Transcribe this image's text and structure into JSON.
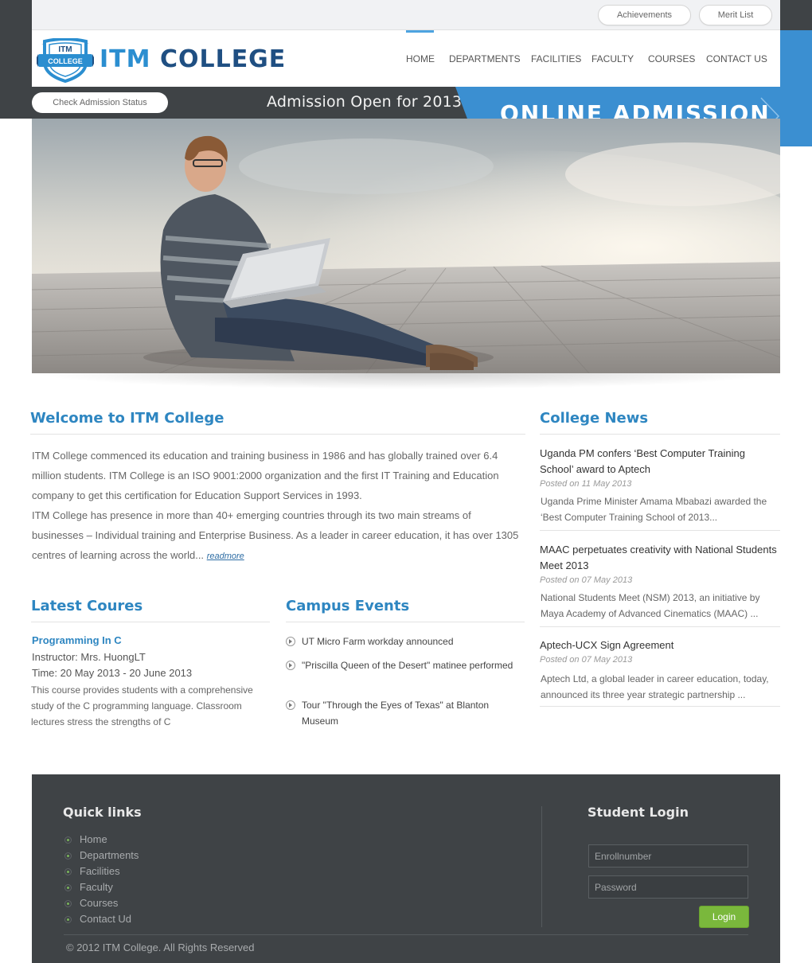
{
  "top_links": [
    "Achievements",
    "Merit List"
  ],
  "logo": {
    "badge_top": "ITM",
    "badge_bottom": "COLLEGE",
    "brand_part1": "ITM",
    "brand_part2": "COLLEGE"
  },
  "nav": [
    "HOME",
    "DEPARTMENTS",
    "FACILITIES",
    "FACULTY",
    "COURSES",
    "CONTACT US"
  ],
  "band": {
    "check_status": "Check Admission Status",
    "admission": "Admission Open for 2013",
    "online_admission": "ONLINE ADMISSION"
  },
  "welcome": {
    "title": "Welcome to ITM College",
    "para1": "ITM College commenced its education and training business in 1986 and has globally trained over 6.4 million students. ITM College is an ISO 9001:2000 organization and the first IT Training and Education company to get this certification for Education Support Services in 1993.",
    "para2": "ITM College has presence in more than 40+ emerging countries through its two main streams of businesses – Individual training and Enterprise Business. As a leader in career education, it has over 1305 centres of learning across the world...",
    "readmore": "readmore"
  },
  "courses": {
    "title": "Latest Coures",
    "name": "Programming In C",
    "instructor": "Instructor: Mrs. HuongLT",
    "time": "Time: 20 May 2013 - 20 June 2013",
    "description": "This course provides students with a comprehensive study of the C programming language. Classroom lectures stress the strengths of C"
  },
  "events": {
    "title": "Campus Events",
    "items": [
      "UT Micro Farm workday announced",
      "\"Priscilla Queen of the Desert\" matinee performed",
      "Tour \"Through the Eyes of Texas\" at Blanton Museum"
    ]
  },
  "news": {
    "title": "College News",
    "items": [
      {
        "title": "Uganda PM confers ‘Best Computer Training School’ award to Aptech",
        "date": "Posted on 11 May 2013",
        "body": "Uganda Prime Minister Amama Mbabazi awarded the ‘Best Computer Training School of 2013..."
      },
      {
        "title": "MAAC perpetuates creativity with National Students Meet 2013",
        "date": "Posted on 07 May 2013",
        "body": "National Students Meet (NSM) 2013, an initiative by Maya Academy of Advanced Cinematics (MAAC) ..."
      },
      {
        "title": "Aptech-UCX Sign Agreement",
        "date": "Posted on 07 May 2013",
        "body": "Aptech Ltd, a global leader in career education, today, announced its three year strategic partnership ..."
      }
    ]
  },
  "footer": {
    "quick_links_title": "Quick links",
    "quick_links": [
      "Home",
      "Departments",
      "Facilities",
      "Faculty",
      "Courses",
      "Contact Ud"
    ],
    "login_title": "Student Login",
    "enroll_placeholder": "Enrollnumber",
    "password_placeholder": "Password",
    "login_button": "Login",
    "copyright": "© 2012 ITM College. All Rights Reserved"
  },
  "colors": {
    "accent_blue": "#2e86c1",
    "dark_band": "#3f4346",
    "login_green": "#7ab83c"
  }
}
